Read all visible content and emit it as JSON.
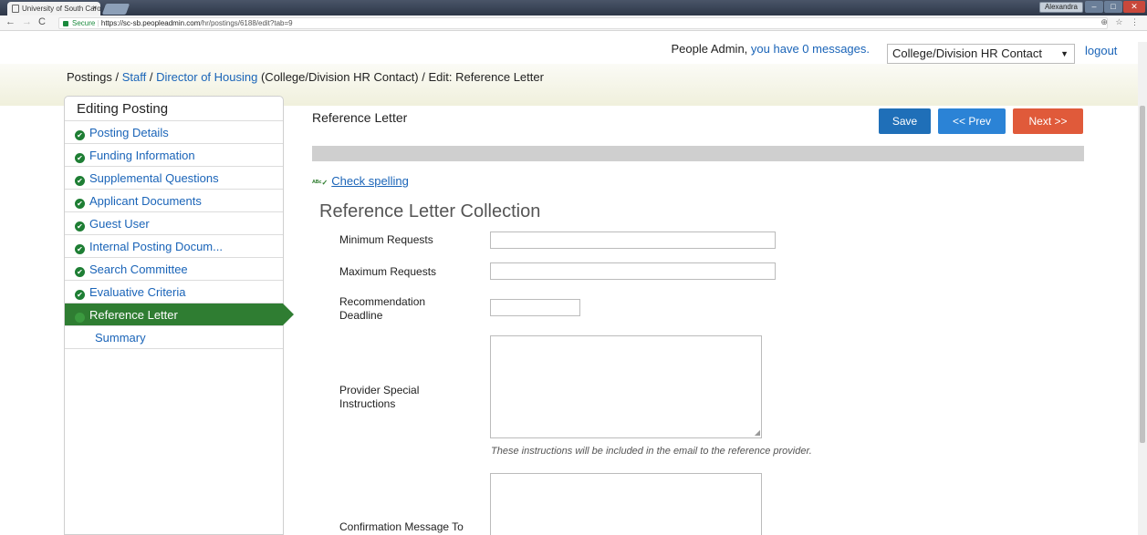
{
  "browser": {
    "tab_title": "University of South Caro",
    "tab_close": "×",
    "url_secure": "Secure",
    "url_host": "https://sc-sb.peopleadmin.com",
    "url_path": "/hr/postings/6188/edit?tab=9",
    "window_user": "Alexandra",
    "min": "–",
    "max": "□",
    "close": "✕",
    "addr_icons": "⊕ ☆ ⋮"
  },
  "header": {
    "greeting": "People Admin,",
    "messages": "you have 0 messages.",
    "role": "College/Division HR Contact",
    "logout": "logout"
  },
  "breadcrumb": {
    "postings": "Postings",
    "sep1": " / ",
    "staff": "Staff",
    "sep2": " / ",
    "position": "Director of Housing",
    "role_note": " (College/Division HR Contact)",
    "sep3": " / ",
    "current": "Edit: Reference Letter"
  },
  "sidebar": {
    "heading": "Editing Posting",
    "items": [
      {
        "label": "Posting Details"
      },
      {
        "label": "Funding Information"
      },
      {
        "label": "Supplemental Questions"
      },
      {
        "label": "Applicant Documents"
      },
      {
        "label": "Guest User"
      },
      {
        "label": "Internal Posting Docum..."
      },
      {
        "label": "Search Committee"
      },
      {
        "label": "Evaluative Criteria"
      },
      {
        "label": "Reference Letter"
      },
      {
        "label": "Summary"
      }
    ]
  },
  "main": {
    "title": "Reference Letter",
    "save": "Save",
    "prev": "<< Prev",
    "next": "Next >>",
    "check_spelling": "Check spelling",
    "section_title": "Reference Letter Collection",
    "labels": {
      "minimum": "Minimum Requests",
      "maximum": "Maximum Requests",
      "deadline": "Recommendation Deadline",
      "instructions": "Provider Special Instructions",
      "confirmation": "Confirmation Message To"
    },
    "values": {
      "minimum": "",
      "maximum": "",
      "deadline": "",
      "instructions": "",
      "confirmation": ""
    },
    "hint": "These instructions will be included in the email to the reference provider."
  }
}
